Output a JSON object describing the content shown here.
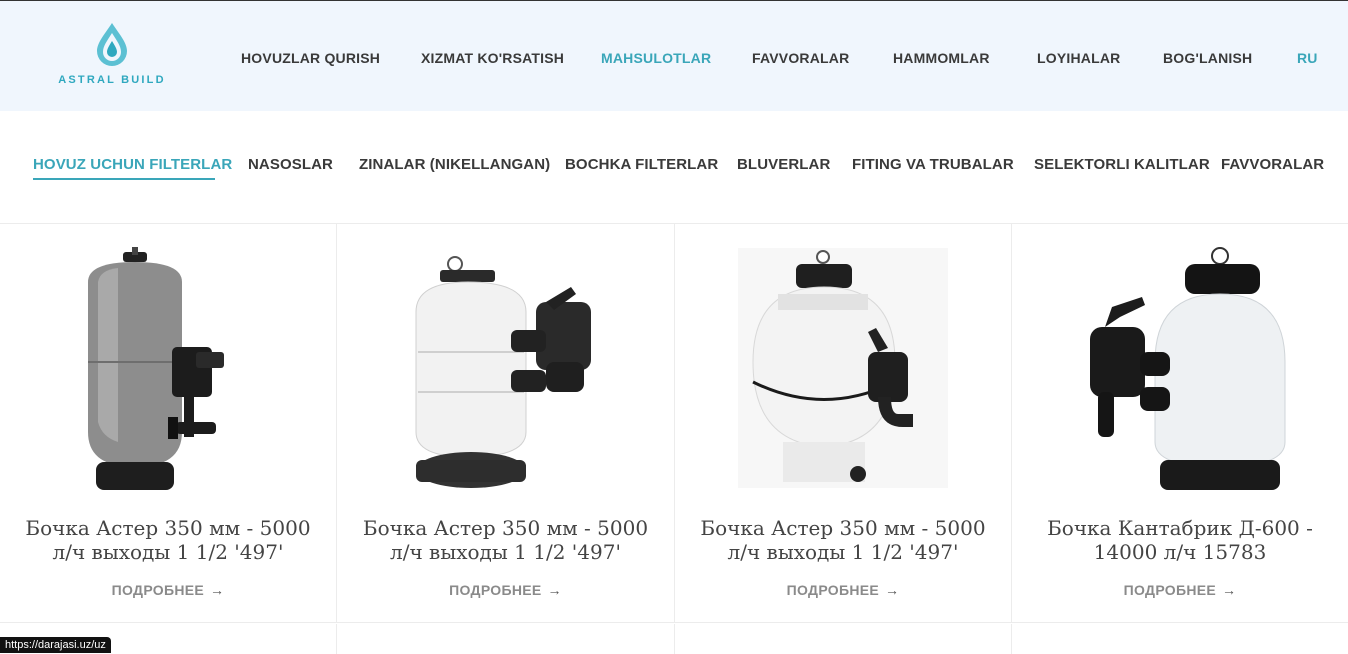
{
  "header": {
    "logo_text": "ASTRAL BUILD",
    "nav": [
      {
        "label": "HOVUZLAR QURISH"
      },
      {
        "label": "XIZMAT KO'RSATISH"
      },
      {
        "label": "MAHSULOTLAR",
        "active": true
      },
      {
        "label": "FAVVORALAR"
      },
      {
        "label": "HAMMOMLAR"
      },
      {
        "label": "LOYIHALAR"
      },
      {
        "label": "BOG'LANISH"
      }
    ],
    "lang": "RU"
  },
  "categories": [
    {
      "label": "HOVUZ UCHUN FILTERLAR",
      "active": true
    },
    {
      "label": "NASOSLAR"
    },
    {
      "label": "ZINALAR (NIKELLANGAN)"
    },
    {
      "label": "BOCHKA FILTERLAR"
    },
    {
      "label": "BLUVERLAR"
    },
    {
      "label": "FITING VA TRUBALAR"
    },
    {
      "label": "SELEKTORLI KALITLAR"
    },
    {
      "label": "FAVVORALAR"
    }
  ],
  "products": [
    {
      "title": "Бочка Астер 350 мм - 5000 л/ч выходы 1 1/2 '497'",
      "more": "ПОДРОБНЕЕ"
    },
    {
      "title": "Бочка Астер 350 мм - 5000 л/ч выходы 1 1/2 '497'",
      "more": "ПОДРОБНЕЕ"
    },
    {
      "title": "Бочка Астер 350 мм - 5000 л/ч выходы 1 1/2 '497'",
      "more": "ПОДРОБНЕЕ"
    },
    {
      "title": "Бочка Кантабрик Д-600 - 14000 л/ч 15783",
      "more": "ПОДРОБНЕЕ"
    }
  ],
  "status_url": "https://darajasi.uz/uz",
  "colors": {
    "accent": "#3aa6b9",
    "header_bg": "#f0f6fd",
    "text": "#3a3a3a"
  }
}
